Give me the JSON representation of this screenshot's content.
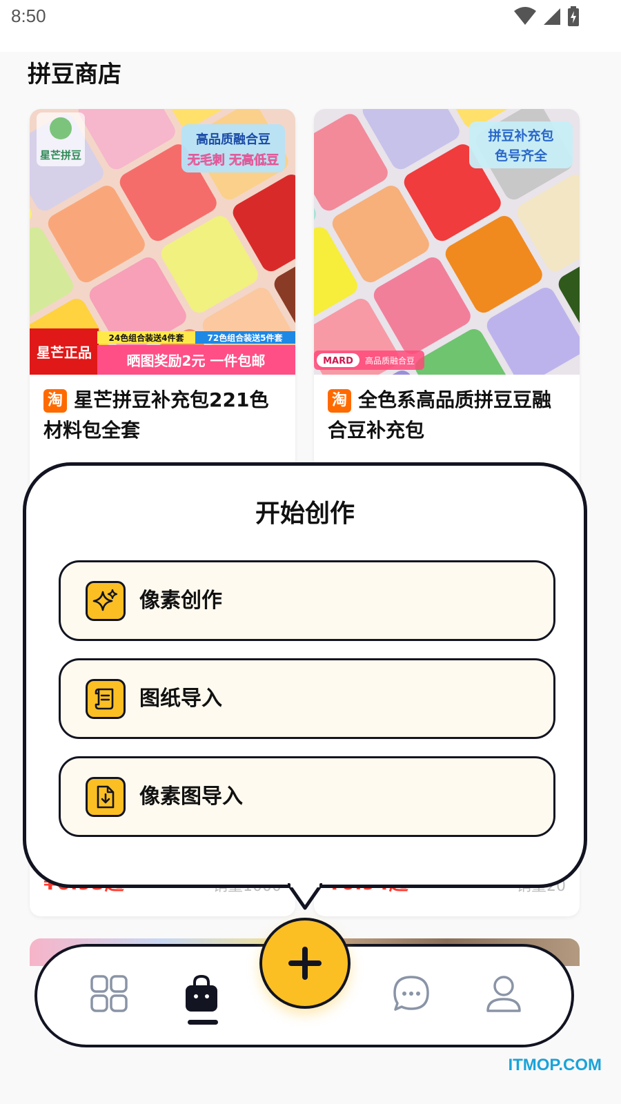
{
  "status": {
    "time": "8:50"
  },
  "page": {
    "title": "拼豆商店"
  },
  "products": [
    {
      "badge": "淘",
      "title": "星芒拼豆补充包221色材料包全套",
      "price": "¥0.95起",
      "sales": "销量1000",
      "image": {
        "brand": "星芒拼豆",
        "tag1": "高品质融合豆",
        "tag2": "无毛刺 无高低豆",
        "corner": "星芒正品",
        "promo1": "24色组合装送4件套",
        "promo2": "72色组合装送5件套",
        "promo3": "晒图奖励2元 一件包邮"
      }
    },
    {
      "badge": "淘",
      "title": "全色系高品质拼豆豆融合豆补充包",
      "price": "¥0.94起",
      "sales": "销量20",
      "image": {
        "tag1": "拼豆补充包",
        "tag2": "色号齐全",
        "brand": "MARD",
        "brand_sub": "高品质融合豆"
      }
    }
  ],
  "popover": {
    "title": "开始创作",
    "options": [
      {
        "label": "像素创作",
        "icon": "sparkle-icon"
      },
      {
        "label": "图纸导入",
        "icon": "scroll-icon"
      },
      {
        "label": "像素图导入",
        "icon": "file-import-icon"
      }
    ]
  },
  "nav": {
    "items": [
      {
        "icon": "grid-icon",
        "active": false
      },
      {
        "icon": "shopping-bag-icon",
        "active": true
      },
      {
        "icon": "chat-icon",
        "active": false
      },
      {
        "icon": "user-icon",
        "active": false
      }
    ],
    "fab_icon": "plus-icon"
  },
  "watermark": "ITMOP.COM",
  "colors": {
    "accent": "#fbbf24",
    "outline": "#121421",
    "option_bg": "#fffaef",
    "price": "#ff3b30"
  }
}
